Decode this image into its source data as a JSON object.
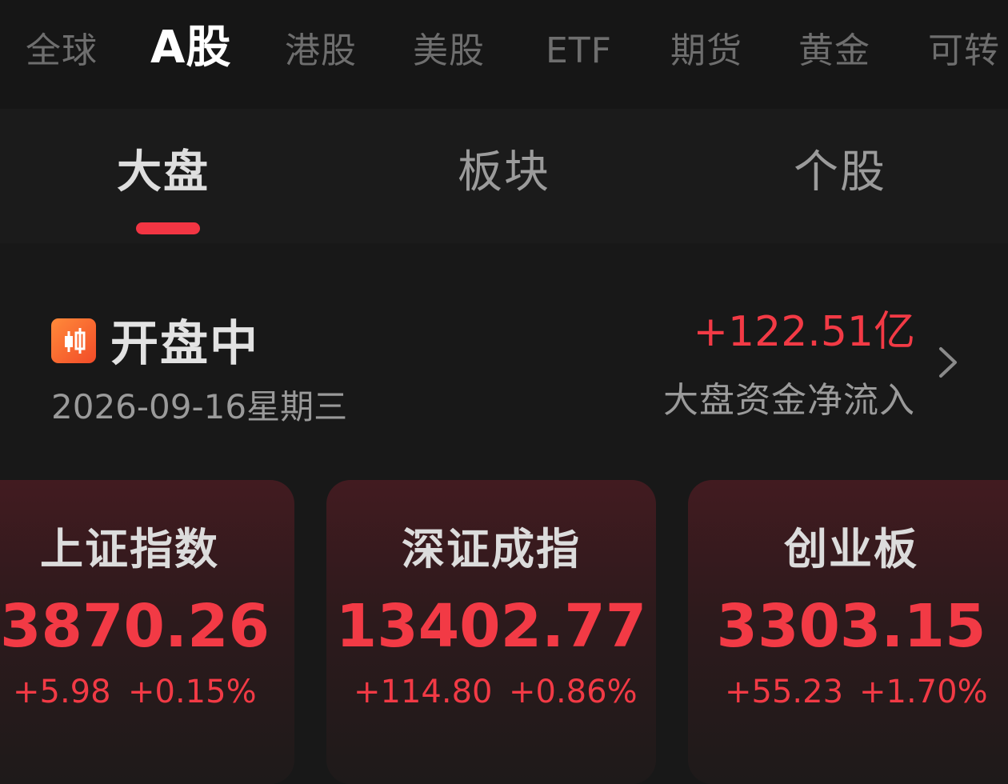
{
  "market_tabs": [
    {
      "label": "全球",
      "active": false
    },
    {
      "label": "A股",
      "active": true
    },
    {
      "label": "港股",
      "active": false
    },
    {
      "label": "美股",
      "active": false
    },
    {
      "label": "ETF",
      "active": false
    },
    {
      "label": "期货",
      "active": false
    },
    {
      "label": "黄金",
      "active": false
    },
    {
      "label": "可转",
      "active": false
    }
  ],
  "sub_tabs": [
    {
      "label": "大盘",
      "active": true
    },
    {
      "label": "板块",
      "active": false
    },
    {
      "label": "个股",
      "active": false
    }
  ],
  "status": {
    "icon": "candlestick-icon",
    "label": "开盘中",
    "date": "2026-09-16星期三"
  },
  "capital_flow": {
    "value": "+122.51亿",
    "label": "大盘资金净流入"
  },
  "indices": [
    {
      "name": "上证指数",
      "value": "3870.26",
      "change": "+5.98",
      "pct": "+0.15%"
    },
    {
      "name": "深证成指",
      "value": "13402.77",
      "change": "+114.80",
      "pct": "+0.86%"
    },
    {
      "name": "创业板",
      "value": "3303.15",
      "change": "+55.23",
      "pct": "+1.70%"
    }
  ],
  "colors": {
    "accent_red": "#f23a45",
    "background": "#181818",
    "icon_orange": "#f25a2e"
  }
}
